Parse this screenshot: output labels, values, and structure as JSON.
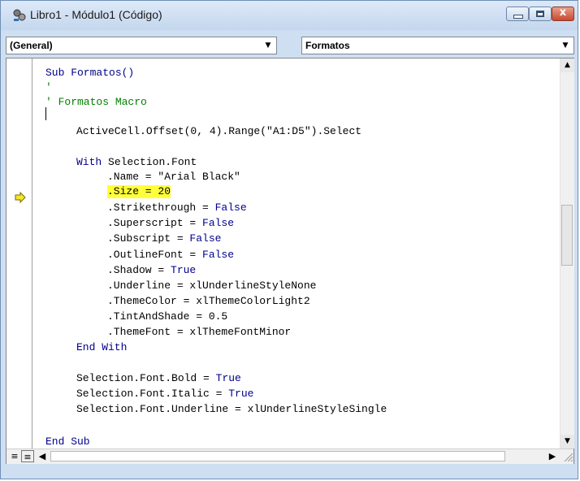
{
  "window": {
    "title": "Libro1 - Módulo1 (Código)",
    "close_glyph": "x"
  },
  "combos": {
    "object": "(General)",
    "procedure": "Formatos"
  },
  "icons": {
    "app": "vba-module-icon",
    "execution": "execution-arrow-icon",
    "dropdown": "chevron-down-icon",
    "scroll_up": "scroll-up-icon",
    "scroll_down": "scroll-down-icon",
    "scroll_left": "scroll-left-icon",
    "scroll_right": "scroll-right-icon"
  },
  "colors": {
    "keyword": "#00008b",
    "comment": "#008000",
    "highlight": "#ffff3a",
    "exec_arrow": "#f5e62a"
  },
  "code": {
    "l1": "Sub Formatos()",
    "l2": "'",
    "l3": "' Formatos Macro",
    "l4": "'",
    "l5": "ActiveCell.Offset(0, 4).Range(\"A1:D5\").Select",
    "l6_kw": "With",
    "l6_rest": "Selection.Font",
    "l7": ".Name = \"Arial Black\"",
    "l8": ".Size = 20",
    "l9_a": ".Strikethrough = ",
    "l9_kw": "False",
    "l10_a": ".Superscript = ",
    "l10_kw": "False",
    "l11_a": ".Subscript = ",
    "l11_kw": "False",
    "l12_a": ".OutlineFont = ",
    "l12_kw": "False",
    "l13_a": ".Shadow = ",
    "l13_kw": "True",
    "l14": ".Underline = xlUnderlineStyleNone",
    "l15": ".ThemeColor = xlThemeColorLight2",
    "l16": ".TintAndShade = 0.5",
    "l17": ".ThemeFont = xlThemeFontMinor",
    "l18": "End With",
    "l19_a": "Selection.Font.Bold = ",
    "l19_kw": "True",
    "l20_a": "Selection.Font.Italic = ",
    "l20_kw": "True",
    "l21": "Selection.Font.Underline = xlUnderlineStyleSingle",
    "l22": "End Sub"
  }
}
